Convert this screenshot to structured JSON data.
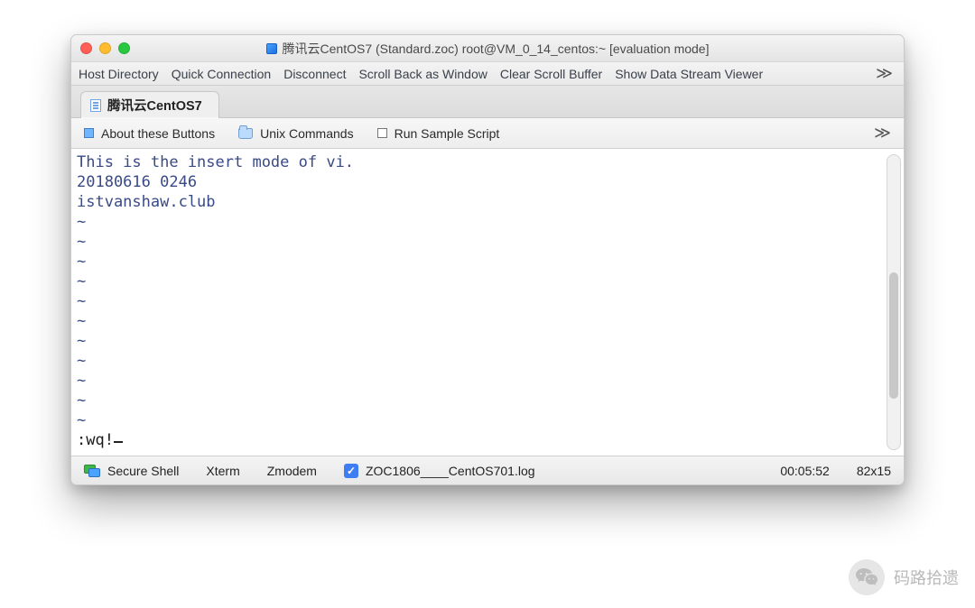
{
  "window": {
    "title": "腾讯云CentOS7 (Standard.zoc) root@VM_0_14_centos:~ [evaluation mode]"
  },
  "menubar": {
    "items": [
      "Host Directory",
      "Quick Connection",
      "Disconnect",
      "Scroll Back as Window",
      "Clear Scroll Buffer",
      "Show Data Stream Viewer"
    ],
    "more": "≫"
  },
  "tabs": {
    "active": "腾讯云CentOS7"
  },
  "btnbar": {
    "about": "About these Buttons",
    "unix": "Unix Commands",
    "run": "Run Sample Script",
    "more": "≫"
  },
  "terminal": {
    "lines": [
      "This is the insert mode of vi.",
      "20180616 0246",
      "istvanshaw.club"
    ],
    "tilde": "~",
    "command": ":wq!"
  },
  "statusbar": {
    "shell": "Secure Shell",
    "term": "Xterm",
    "protocol": "Zmodem",
    "log_enabled": true,
    "log_file": "ZOC1806____CentOS701.log",
    "elapsed": "00:05:52",
    "size": "82x15"
  },
  "watermark": {
    "text": "码路拾遗"
  }
}
